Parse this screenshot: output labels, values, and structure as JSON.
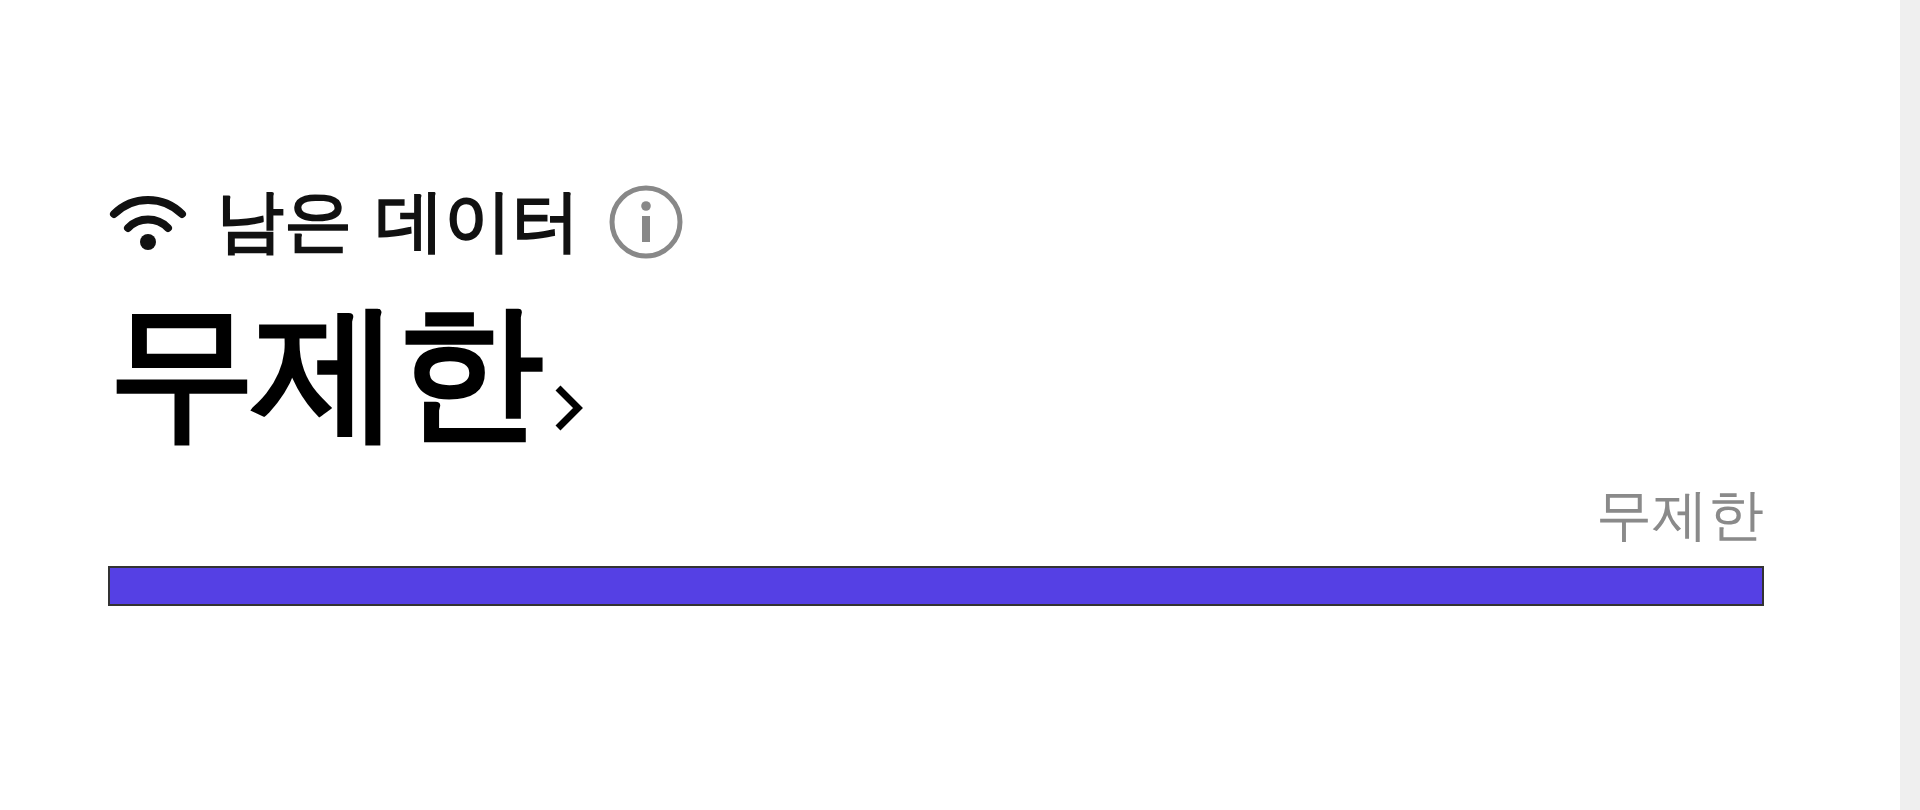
{
  "title": "남은 데이터",
  "value": "무제한",
  "meter": {
    "label": "무제한",
    "level": 1
  }
}
